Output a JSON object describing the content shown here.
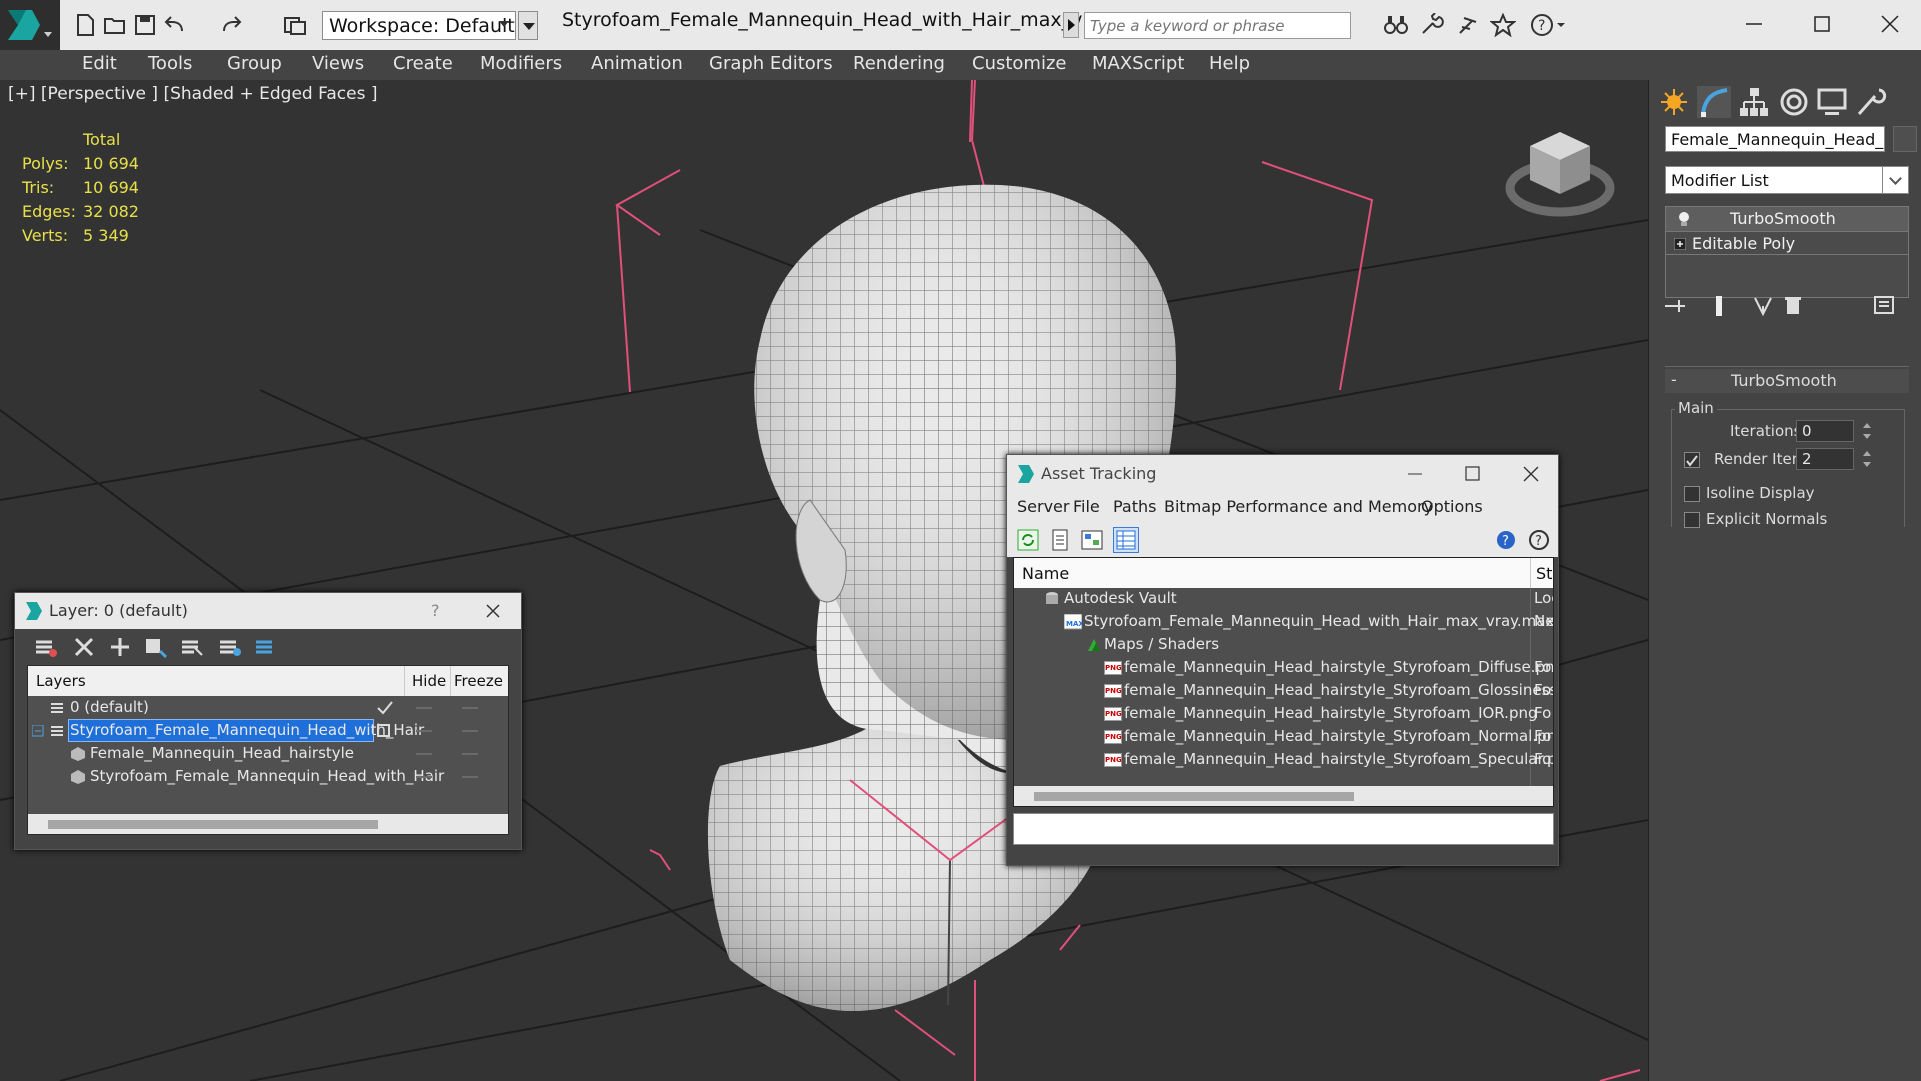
{
  "titlebar": {
    "workspace_label": "Workspace: Default",
    "document_title": "Styrofoam_Female_Mannequin_Head_with_Hair_max_vray.m...",
    "search_placeholder": "Type a keyword or phrase"
  },
  "menu": {
    "items": [
      "Edit",
      "Tools",
      "Group",
      "Views",
      "Create",
      "Modifiers",
      "Animation",
      "Graph Editors",
      "Rendering",
      "Customize",
      "MAXScript",
      "Help"
    ]
  },
  "viewport": {
    "label": "[+] [Perspective ] [Shaded + Edged Faces ]",
    "stats": {
      "header": "Total",
      "rows": [
        {
          "key": "Polys:",
          "value": "10 694"
        },
        {
          "key": "Tris:",
          "value": "10 694"
        },
        {
          "key": "Edges:",
          "value": "32 082"
        },
        {
          "key": "Verts:",
          "value": "5 349"
        }
      ]
    }
  },
  "command_panel": {
    "object_name": "Female_Mannequin_Head_hairstyle",
    "modifier_list_label": "Modifier List",
    "stack": [
      "TurboSmooth",
      "Editable Poly"
    ],
    "rollout_title": "TurboSmooth",
    "group_label": "Main",
    "iterations_label": "Iterations:",
    "iterations_value": "0",
    "render_iters_label": "Render Iters:",
    "render_iters_value": "2",
    "isoline_label": "Isoline Display",
    "explicit_normals_label": "Explicit Normals"
  },
  "layer_window": {
    "title": "Layer: 0 (default)",
    "help": "?",
    "columns": {
      "layers": "Layers",
      "hide": "Hide",
      "freeze": "Freeze"
    },
    "rows": [
      {
        "name": "0 (default)",
        "level": 0
      },
      {
        "name": "Styrofoam_Female_Mannequin_Head_with_Hair",
        "level": 0
      },
      {
        "name": "Female_Mannequin_Head_hairstyle",
        "level": 1
      },
      {
        "name": "Styrofoam_Female_Mannequin_Head_with_Hair",
        "level": 1
      }
    ]
  },
  "asset_window": {
    "title": "Asset Tracking",
    "menu": [
      "Server",
      "File",
      "Paths",
      "Bitmap Performance and Memory",
      "Options"
    ],
    "columns": {
      "name": "Name",
      "status": "Sta"
    },
    "rows": [
      {
        "name": "Autodesk Vault",
        "status": "Loc"
      },
      {
        "name": "Styrofoam_Female_Mannequin_Head_with_Hair_max_vray.max",
        "status": "Ne"
      },
      {
        "name": "Maps / Shaders",
        "status": ""
      },
      {
        "name": "female_Mannequin_Head_hairstyle_Styrofoam_Diffuse.png",
        "status": "Fo"
      },
      {
        "name": "female_Mannequin_Head_hairstyle_Styrofoam_Glossiness.png",
        "status": "Fo"
      },
      {
        "name": "female_Mannequin_Head_hairstyle_Styrofoam_IOR.png",
        "status": "Fo"
      },
      {
        "name": "female_Mannequin_Head_hairstyle_Styrofoam_Normal.png",
        "status": "Fo"
      },
      {
        "name": "female_Mannequin_Head_hairstyle_Styrofoam_Specular.png",
        "status": "Fo"
      }
    ],
    "png_badge": "PNG"
  },
  "colors": {
    "accent_blue": "#1e6fd9",
    "stat_yellow": "#e8e04a",
    "bbox_pink": "#e0507a",
    "grid": "#1c1c1c"
  }
}
